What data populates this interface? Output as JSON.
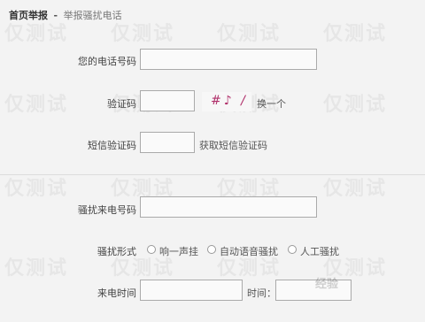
{
  "breadcrumb": {
    "home": "首页举报",
    "separator": "-",
    "current": "举报骚扰电话"
  },
  "form": {
    "phone_label": "您的电话号码",
    "captcha_label": "验证码",
    "captcha_image_text": "#♪ /",
    "captcha_refresh": "换一个",
    "sms_code_label": "短信验证码",
    "sms_code_link": "获取短信验证码",
    "caller_label": "骚扰来电号码",
    "type_label": "骚扰形式",
    "type_options": [
      "响一声挂",
      "自动语音骚扰",
      "人工骚扰"
    ],
    "time_label": "来电时间",
    "time_label2": "时间："
  },
  "watermark_text": "仅测试",
  "logo_text": "经验"
}
